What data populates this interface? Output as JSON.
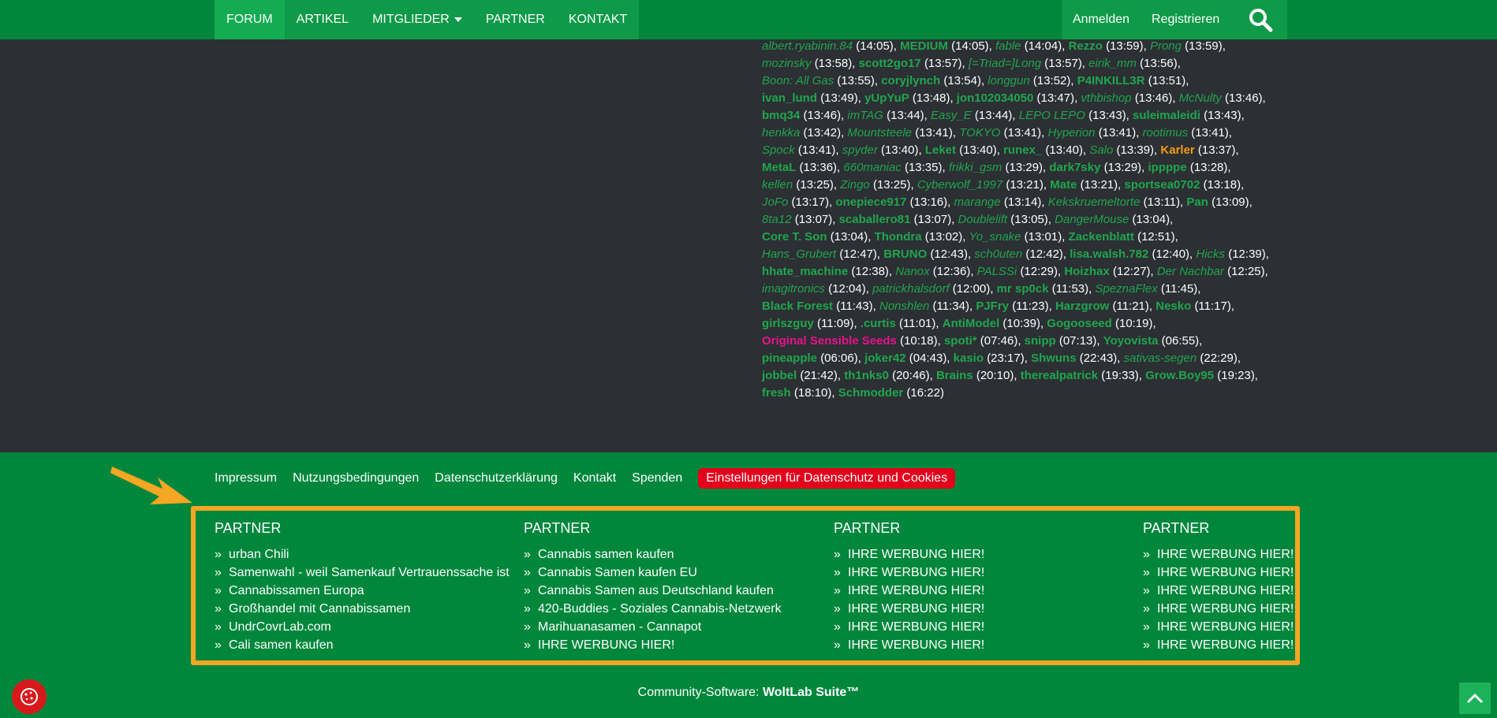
{
  "nav": {
    "items": [
      "FORUM",
      "ARTIKEL",
      "MITGLIEDER",
      "PARTNER",
      "KONTAKT"
    ],
    "login": "Anmelden",
    "register": "Registrieren"
  },
  "online_users": [
    {
      "name": "albert.ryabinin.84",
      "time": "(14:05),",
      "style": "g"
    },
    {
      "name": "MEDIUM",
      "time": "(14:05),",
      "style": "m"
    },
    {
      "name": "fable",
      "time": "(14:04),",
      "style": "g"
    },
    {
      "name": "Rezzo",
      "time": "(13:59),",
      "style": "m"
    },
    {
      "name": "Prong",
      "time": "(13:59),",
      "style": "g"
    },
    {
      "name": "mozinsky",
      "time": "(13:58),",
      "style": "g"
    },
    {
      "name": "scott2go17",
      "time": "(13:57),",
      "style": "m"
    },
    {
      "name": "[=Triad=]Long",
      "time": "(13:57),",
      "style": "g"
    },
    {
      "name": "eirik_mm",
      "time": "(13:56),",
      "style": "g"
    },
    {
      "name": "Boon: All Gas",
      "time": "(13:55),",
      "style": "g"
    },
    {
      "name": "coryjlynch",
      "time": "(13:54),",
      "style": "m"
    },
    {
      "name": "longgun",
      "time": "(13:52),",
      "style": "g"
    },
    {
      "name": "P4INKILL3R",
      "time": "(13:51),",
      "style": "m"
    },
    {
      "name": "ivan_lund",
      "time": "(13:49),",
      "style": "m"
    },
    {
      "name": "yUpYuP",
      "time": "(13:48),",
      "style": "m"
    },
    {
      "name": "jon102034050",
      "time": "(13:47),",
      "style": "m"
    },
    {
      "name": "vthbishop",
      "time": "(13:46),",
      "style": "g"
    },
    {
      "name": "McNulty",
      "time": "(13:46),",
      "style": "g"
    },
    {
      "name": "bmq34",
      "time": "(13:46),",
      "style": "m"
    },
    {
      "name": "imTAG",
      "time": "(13:44),",
      "style": "g"
    },
    {
      "name": "Easy_E",
      "time": "(13:44),",
      "style": "g"
    },
    {
      "name": "LEPO LEPO",
      "time": "(13:43),",
      "style": "g"
    },
    {
      "name": "suleimaleidi",
      "time": "(13:43),",
      "style": "m"
    },
    {
      "name": "henkka",
      "time": "(13:42),",
      "style": "g"
    },
    {
      "name": "Mountsteele",
      "time": "(13:41),",
      "style": "g"
    },
    {
      "name": "TOKYO",
      "time": "(13:41),",
      "style": "g"
    },
    {
      "name": "Hyperion",
      "time": "(13:41),",
      "style": "g"
    },
    {
      "name": "rootimus",
      "time": "(13:41),",
      "style": "g"
    },
    {
      "name": "Spock",
      "time": "(13:41),",
      "style": "g"
    },
    {
      "name": "spyder",
      "time": "(13:40),",
      "style": "g"
    },
    {
      "name": "Leket",
      "time": "(13:40),",
      "style": "m"
    },
    {
      "name": "runex_",
      "time": "(13:40),",
      "style": "m"
    },
    {
      "name": "Salo",
      "time": "(13:39),",
      "style": "g"
    },
    {
      "name": "Karler",
      "time": "(13:37),",
      "style": "o"
    },
    {
      "name": "MetaL",
      "time": "(13:36),",
      "style": "m"
    },
    {
      "name": "660maniac",
      "time": "(13:35),",
      "style": "g"
    },
    {
      "name": "frikki_gsm",
      "time": "(13:29),",
      "style": "g"
    },
    {
      "name": "dark7sky",
      "time": "(13:29),",
      "style": "m"
    },
    {
      "name": "ippppe",
      "time": "(13:28),",
      "style": "m"
    },
    {
      "name": "kellen",
      "time": "(13:25),",
      "style": "g"
    },
    {
      "name": "Zingo",
      "time": "(13:25),",
      "style": "g"
    },
    {
      "name": "Cyberwolf_1997",
      "time": "(13:21),",
      "style": "g"
    },
    {
      "name": "Mate",
      "time": "(13:21),",
      "style": "m"
    },
    {
      "name": "sportsea0702",
      "time": "(13:18),",
      "style": "m"
    },
    {
      "name": "JoFo",
      "time": "(13:17),",
      "style": "g"
    },
    {
      "name": "onepiece917",
      "time": "(13:16),",
      "style": "m"
    },
    {
      "name": "marange",
      "time": "(13:14),",
      "style": "g"
    },
    {
      "name": "Kekskruemeltorte",
      "time": "(13:11),",
      "style": "g"
    },
    {
      "name": "Pan",
      "time": "(13:09),",
      "style": "m"
    },
    {
      "name": "8ta12",
      "time": "(13:07),",
      "style": "g"
    },
    {
      "name": "scaballero81",
      "time": "(13:07),",
      "style": "m"
    },
    {
      "name": "Doublelift",
      "time": "(13:05),",
      "style": "g"
    },
    {
      "name": "DangerMouse",
      "time": "(13:04),",
      "style": "g"
    },
    {
      "name": "Core T. Son",
      "time": "(13:04),",
      "style": "m"
    },
    {
      "name": "Thondra",
      "time": "(13:02),",
      "style": "m"
    },
    {
      "name": "Yo_snake",
      "time": "(13:01),",
      "style": "g"
    },
    {
      "name": "Zackenblatt",
      "time": "(12:51),",
      "style": "m"
    },
    {
      "name": "Hans_Grubert",
      "time": "(12:47),",
      "style": "g"
    },
    {
      "name": "BRUNO",
      "time": "(12:43),",
      "style": "m"
    },
    {
      "name": "sch0uten",
      "time": "(12:42),",
      "style": "g"
    },
    {
      "name": "lisa.walsh.782",
      "time": "(12:40),",
      "style": "m"
    },
    {
      "name": "Hicks",
      "time": "(12:39),",
      "style": "g"
    },
    {
      "name": "hhate_machine",
      "time": "(12:38),",
      "style": "m"
    },
    {
      "name": "Nanox",
      "time": "(12:36),",
      "style": "g"
    },
    {
      "name": "PALSSi",
      "time": "(12:29),",
      "style": "g"
    },
    {
      "name": "Hoizhax",
      "time": "(12:27),",
      "style": "m"
    },
    {
      "name": "Der Nachbar",
      "time": "(12:25),",
      "style": "g"
    },
    {
      "name": "imagitronics",
      "time": "(12:04),",
      "style": "g"
    },
    {
      "name": "patrickhalsdorf",
      "time": "(12:00),",
      "style": "g"
    },
    {
      "name": "mr sp0ck",
      "time": "(11:53),",
      "style": "m"
    },
    {
      "name": "SpeznaFlex",
      "time": "(11:45),",
      "style": "g"
    },
    {
      "name": "Black Forest",
      "time": "(11:43),",
      "style": "m"
    },
    {
      "name": "Nonshlen",
      "time": "(11:34),",
      "style": "g"
    },
    {
      "name": "PJFry",
      "time": "(11:23),",
      "style": "m"
    },
    {
      "name": "Harzgrow",
      "time": "(11:21),",
      "style": "m"
    },
    {
      "name": "Nesko",
      "time": "(11:17),",
      "style": "m"
    },
    {
      "name": "girlszguy",
      "time": "(11:09),",
      "style": "m"
    },
    {
      "name": ".curtis",
      "time": "(11:01),",
      "style": "m"
    },
    {
      "name": "AntiModel",
      "time": "(10:39),",
      "style": "m"
    },
    {
      "name": "Gogooseed",
      "time": "(10:19),",
      "style": "m"
    },
    {
      "name": "Original Sensible Seeds",
      "time": "(10:18),",
      "style": "p"
    },
    {
      "name": "spoti*",
      "time": "(07:46),",
      "style": "m"
    },
    {
      "name": "snipp",
      "time": "(07:13),",
      "style": "m"
    },
    {
      "name": "Yoyovista",
      "time": "(06:55),",
      "style": "m"
    },
    {
      "name": "pineapple",
      "time": "(06:06),",
      "style": "m"
    },
    {
      "name": "joker42",
      "time": "(04:43),",
      "style": "m"
    },
    {
      "name": "kasio",
      "time": "(23:17),",
      "style": "m"
    },
    {
      "name": "Shwuns",
      "time": "(22:43),",
      "style": "m"
    },
    {
      "name": "sativas-segen",
      "time": "(22:29),",
      "style": "g"
    },
    {
      "name": "jobbel",
      "time": "(21:42),",
      "style": "m"
    },
    {
      "name": "th1nks0",
      "time": "(20:46),",
      "style": "m"
    },
    {
      "name": "Brains",
      "time": "(20:10),",
      "style": "m"
    },
    {
      "name": "therealpatrick",
      "time": "(19:33),",
      "style": "m"
    },
    {
      "name": "Grow.Boy95",
      "time": "(19:23),",
      "style": "m"
    },
    {
      "name": "fresh",
      "time": "(18:10),",
      "style": "m"
    },
    {
      "name": "Schmodder",
      "time": "(16:22)",
      "style": "m"
    }
  ],
  "online_lines": [
    [
      0,
      1,
      2,
      3,
      4
    ],
    [
      5,
      6,
      7,
      8
    ],
    [
      9,
      10,
      11,
      12
    ],
    [
      13,
      14,
      15,
      16,
      17
    ],
    [
      18,
      19,
      20,
      21,
      22
    ],
    [
      23,
      24,
      25,
      26,
      27
    ],
    [
      28,
      29,
      30,
      31,
      32,
      33
    ],
    [
      34,
      35,
      36,
      37,
      38
    ],
    [
      39,
      40,
      41,
      42,
      43
    ],
    [
      44,
      45,
      46,
      47,
      48
    ],
    [
      49,
      50,
      51,
      52
    ],
    [
      53,
      54,
      55,
      56
    ],
    [
      57,
      58,
      59,
      60,
      61
    ],
    [
      62,
      63,
      64,
      65,
      66
    ],
    [
      67,
      68,
      69,
      70
    ],
    [
      71,
      72,
      73,
      74,
      75
    ],
    [
      76,
      77,
      78,
      79
    ],
    [
      80,
      81,
      82,
      83
    ],
    [
      84,
      85,
      86,
      87,
      88
    ],
    [
      89,
      90,
      91,
      92,
      93
    ],
    [
      94,
      95
    ]
  ],
  "footer": {
    "links": [
      "Impressum",
      "Nutzungsbedingungen",
      "Datenschutzerklärung",
      "Kontakt",
      "Spenden"
    ],
    "cookie_settings": "Einstellungen für Datenschutz und Cookies",
    "partner_columns": [
      {
        "title": "PARTNER",
        "links": [
          "urban Chili",
          "Samenwahl - weil Samenkauf Vertrauenssache ist",
          "Cannabissamen Europa",
          "Großhandel mit Cannabissamen",
          "UndrCovrLab.com",
          "Cali samen kaufen"
        ]
      },
      {
        "title": "PARTNER",
        "links": [
          "Cannabis samen kaufen",
          "Cannabis Samen kaufen EU",
          "Cannabis Samen aus Deutschland kaufen",
          "420-Buddies - Soziales Cannabis-Netzwerk",
          "Marihuanasamen - Cannapot",
          "IHRE WERBUNG HIER!"
        ]
      },
      {
        "title": "PARTNER",
        "links": [
          "IHRE WERBUNG HIER!",
          "IHRE WERBUNG HIER!",
          "IHRE WERBUNG HIER!",
          "IHRE WERBUNG HIER!",
          "IHRE WERBUNG HIER!",
          "IHRE WERBUNG HIER!"
        ]
      },
      {
        "title": "PARTNER",
        "links": [
          "IHRE WERBUNG HIER!",
          "IHRE WERBUNG HIER!",
          "IHRE WERBUNG HIER!",
          "IHRE WERBUNG HIER!",
          "IHRE WERBUNG HIER!",
          "IHRE WERBUNG HIER!"
        ]
      }
    ],
    "copyright_prefix": "Community-Software: ",
    "copyright_brand": "WoltLab Suite™"
  },
  "icons": {
    "search": "search-icon",
    "chevron_double_right": "double-chevron-right-icon",
    "cookie": "cookie-icon",
    "scroll_top": "arrow-up-icon",
    "annotation_arrow": "arrow-annotation-icon"
  },
  "colors": {
    "nav_bg": "#00873c",
    "member_green": "#1fa64e",
    "highlight_orange": "#f39c12",
    "sponsor_pink": "#e6138c",
    "cookie_red": "#e3001b",
    "partner_border": "#f5a623"
  }
}
